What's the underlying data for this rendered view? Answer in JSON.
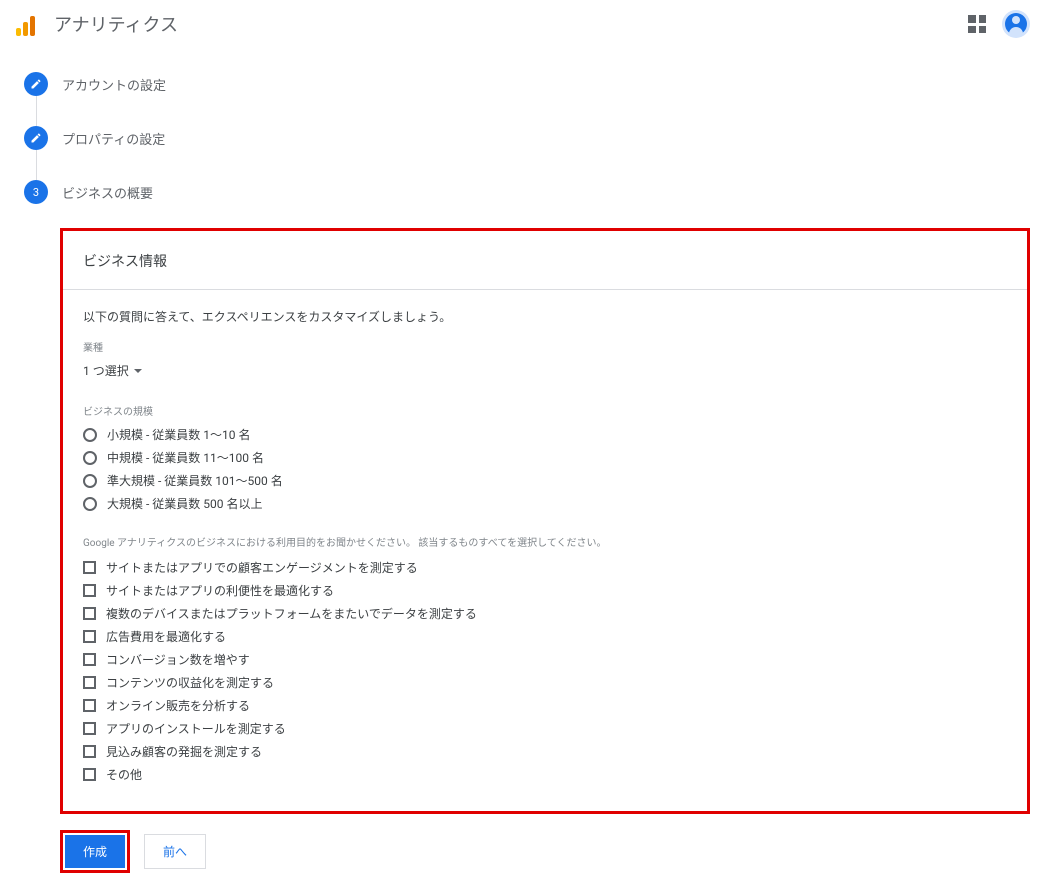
{
  "app": {
    "title": "アナリティクス"
  },
  "steps": [
    {
      "label": "アカウントの設定",
      "done": true
    },
    {
      "label": "プロパティの設定",
      "done": true
    },
    {
      "label": "ビジネスの概要",
      "done": false,
      "number": "3"
    }
  ],
  "panel": {
    "title": "ビジネス情報",
    "subtitle": "以下の質問に答えて、エクスペリエンスをカスタマイズしましょう。",
    "industry": {
      "label": "業種",
      "selected": "1 つ選択"
    },
    "size": {
      "label": "ビジネスの規模",
      "options": [
        "小規模 - 従業員数 1～10 名",
        "中規模 - 従業員数 11～100 名",
        "準大規模 - 従業員数 101～500 名",
        "大規模 - 従業員数 500 名以上"
      ]
    },
    "purposes": {
      "label": "Google アナリティクスのビジネスにおける利用目的をお聞かせください。 該当するものすべてを選択してください。",
      "options": [
        "サイトまたはアプリでの顧客エンゲージメントを測定する",
        "サイトまたはアプリの利便性を最適化する",
        "複数のデバイスまたはプラットフォームをまたいでデータを測定する",
        "広告費用を最適化する",
        "コンバージョン数を増やす",
        "コンテンツの収益化を測定する",
        "オンライン販売を分析する",
        "アプリのインストールを測定する",
        "見込み顧客の発掘を測定する",
        "その他"
      ]
    }
  },
  "buttons": {
    "create": "作成",
    "back": "前へ"
  }
}
